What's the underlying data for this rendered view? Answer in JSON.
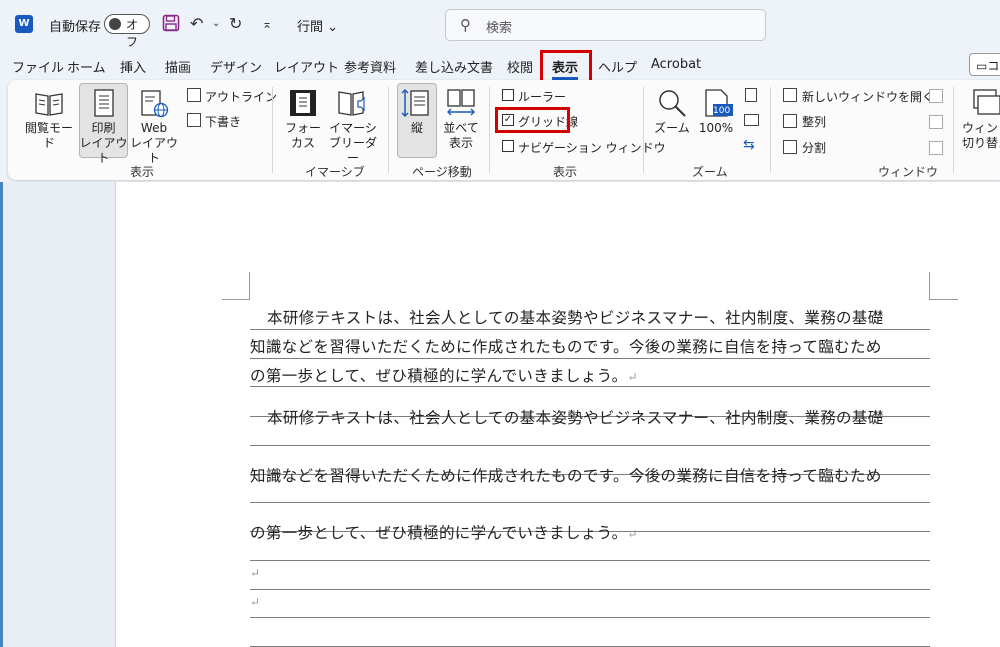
{
  "titlebar": {
    "app_icon": "word-icon",
    "app_letter": "W",
    "autosave_label": "自動保存",
    "autosave_state": "オフ",
    "style_label": "行間",
    "search_placeholder": "検索"
  },
  "tabs": [
    "ファイル",
    "ホーム",
    "挿入",
    "描画",
    "デザイン",
    "レイアウト",
    "参考資料",
    "差し込み文書",
    "校閲",
    "表示",
    "ヘルプ",
    "Acrobat"
  ],
  "active_tab": "表示",
  "comment_button": "コ",
  "ribbon": {
    "view_group": {
      "read_mode": "閲覧モード",
      "print_layout_1": "印刷",
      "print_layout_2": "レイアウト",
      "web_layout_1": "Web",
      "web_layout_2": "レイアウト",
      "outline": "アウトライン",
      "draft": "下書き",
      "group_label": "表示"
    },
    "immersive_group": {
      "focus_1": "フォー",
      "focus_2": "カス",
      "reader_1": "イマーシ",
      "reader_2": "ブリーダー",
      "group_label": "イマーシブ"
    },
    "page_move_group": {
      "vertical": "縦",
      "side_1": "並べて",
      "side_2": "表示",
      "group_label": "ページ移動"
    },
    "show_group": {
      "ruler": "ルーラー",
      "ruler_checked": false,
      "gridlines": "グリッド線",
      "gridlines_checked": true,
      "navigation": "ナビゲーション ウィンドウ",
      "navigation_checked": false,
      "group_label": "表示"
    },
    "zoom_group": {
      "zoom": "ズーム",
      "hundred": "100%",
      "hundred_icon_text": "100",
      "group_label": "ズーム"
    },
    "window_group": {
      "new_window": "新しいウィンドウを開く",
      "arrange": "整列",
      "split": "分割",
      "switch_1": "ウィンド",
      "switch_2": "切り替え",
      "group_label": "ウィンドウ"
    }
  },
  "document": {
    "para1": [
      "本研修テキストは、社会人としての基本姿勢やビジネスマナー、社内制度、業務の基礎",
      "知識などを習得いただくために作成されたものです。今後の業務に自信を持って臨むため",
      "の第一歩として、ぜひ積極的に学んでいきましょう。"
    ],
    "para2": [
      "本研修テキストは、社会人としての基本姿勢やビジネスマナー、社内制度、業務の基礎",
      "知識などを習得いただくために作成されたものです。今後の業務に自信を持って臨むため",
      "の第一歩として、ぜひ積極的に学んでいきましょう。"
    ],
    "para_mark": "↵"
  },
  "colors": {
    "accent": "#185abd",
    "highlight": "#d40000"
  }
}
